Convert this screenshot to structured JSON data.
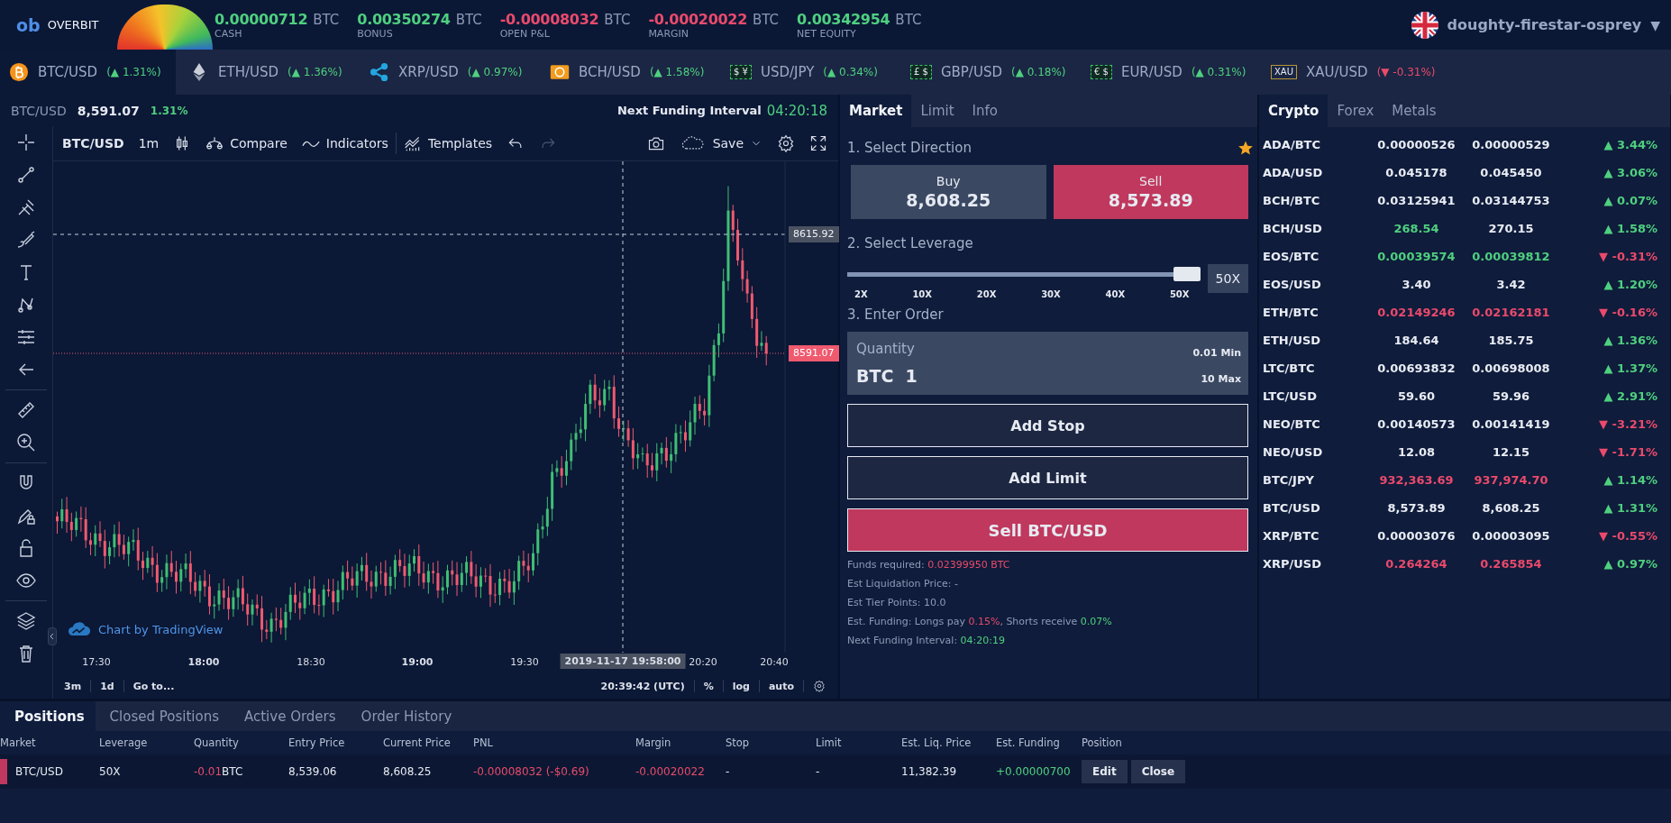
{
  "header": {
    "logo_mark": "ob",
    "logo": "OVERBIT",
    "balances": [
      {
        "value": "0.00000712",
        "unit": "BTC",
        "label": "CASH",
        "color": "#4fd07f"
      },
      {
        "value": "0.00350274",
        "unit": "BTC",
        "label": "BONUS",
        "color": "#4fd07f"
      },
      {
        "value": "-0.00008032",
        "unit": "BTC",
        "label": "OPEN P&L",
        "color": "#ea4a6c"
      },
      {
        "value": "-0.00020022",
        "unit": "BTC",
        "label": "MARGIN",
        "color": "#ea4a6c"
      },
      {
        "value": "0.00342954",
        "unit": "BTC",
        "label": "NET EQUITY",
        "color": "#4fd07f"
      }
    ],
    "user": {
      "name": "doughty-firestar-osprey",
      "caret": "▼"
    }
  },
  "tickers": [
    {
      "kind": "coin",
      "pair": "BTC/USD",
      "change": "(▲ 1.31%)",
      "color": "#4fd07f",
      "selected": true
    },
    {
      "kind": "coin",
      "pair": "ETH/USD",
      "change": "(▲ 1.36%)",
      "color": "#4fd07f",
      "selected": false
    },
    {
      "kind": "coin",
      "pair": "XRP/USD",
      "change": "(▲ 0.97%)",
      "color": "#4fd07f",
      "selected": false
    },
    {
      "kind": "coin",
      "pair": "BCH/USD",
      "change": "(▲ 1.58%)",
      "color": "#4fd07f",
      "selected": false
    },
    {
      "kind": "fx",
      "badge": "$ ¥",
      "pair": "USD/JPY",
      "change": "(▲ 0.34%)",
      "color": "#4fd07f",
      "selected": false
    },
    {
      "kind": "fx",
      "badge": "£ $",
      "pair": "GBP/USD",
      "change": "(▲ 0.18%)",
      "color": "#4fd07f",
      "selected": false
    },
    {
      "kind": "fx",
      "badge": "€ $",
      "pair": "EUR/USD",
      "change": "(▲ 0.31%)",
      "color": "#4fd07f",
      "selected": false
    },
    {
      "kind": "metal",
      "badge": "XAU",
      "pair": "XAU/USD",
      "change": "(▼ -0.31%)",
      "color": "#ea4a6c",
      "selected": false
    }
  ],
  "chart": {
    "symbol": "BTC/USD",
    "price": "8,591.07",
    "change": "1.31%",
    "funding_label": "Next Funding Interval",
    "funding_time": "04:20:18",
    "toolbar": {
      "symbol": "BTC/USD",
      "interval": "1m",
      "compare": "Compare",
      "indicators": "Indicators",
      "templates": "Templates",
      "save": "Save"
    },
    "crosshair_price": "8615.92",
    "last_price": "8591.07",
    "credit": "Chart by TradingView",
    "time_labels": [
      {
        "text": "17:30",
        "major": false
      },
      {
        "text": "18:00",
        "major": true
      },
      {
        "text": "18:30",
        "major": false
      },
      {
        "text": "19:00",
        "major": true
      },
      {
        "text": "19:30",
        "major": false
      },
      {
        "text": "20:20",
        "major": false
      },
      {
        "text": "20:40",
        "major": false
      }
    ],
    "crosshair_time": "2019-11-17 19:58:00",
    "ranges": [
      "3m",
      "1d"
    ],
    "goto": "Go to...",
    "clock": "20:39:42 (UTC)",
    "scale_options": [
      "%",
      "log",
      "auto"
    ]
  },
  "order": {
    "tabs": [
      {
        "label": "Market",
        "selected": true
      },
      {
        "label": "Limit",
        "selected": false
      },
      {
        "label": "Info",
        "selected": false
      }
    ],
    "step1": "1. Select Direction",
    "favorite": true,
    "directions": [
      {
        "label": "Buy",
        "price": "8,608.25",
        "selected": false
      },
      {
        "label": "Sell",
        "price": "8,573.89",
        "selected": true
      }
    ],
    "step2": "2. Select Leverage",
    "leverage": {
      "level": 1,
      "ticks": [
        "2X",
        "10X",
        "20X",
        "30X",
        "40X",
        "50X"
      ],
      "value": "50X"
    },
    "step3": "3. Enter Order",
    "quantity": {
      "label": "Quantity",
      "unit": "BTC",
      "value": "1",
      "min": "0.01 Min",
      "max": "10 Max"
    },
    "add_stop": "Add Stop",
    "add_limit": "Add Limit",
    "submit": "Sell BTC/USD",
    "info": [
      {
        "parts": [
          {
            "text": "Funds required: "
          },
          {
            "text": "0.02399950 BTC",
            "color": "#ea4a6c"
          }
        ]
      },
      {
        "parts": [
          {
            "text": "Est Liquidation Price: -"
          }
        ]
      },
      {
        "parts": [
          {
            "text": "Est Tier Points: 10.0"
          }
        ]
      },
      {
        "parts": [
          {
            "text": "Est. Funding: Longs pay "
          },
          {
            "text": "0.15%",
            "color": "#ea4a6c"
          },
          {
            "text": ", Shorts receive "
          },
          {
            "text": "0.07%",
            "color": "#4fd07f"
          }
        ]
      },
      {
        "parts": [
          {
            "text": "Next Funding Interval: "
          },
          {
            "text": "04:20:19",
            "color": "#4fd07f"
          }
        ]
      }
    ]
  },
  "markets": {
    "tabs": [
      {
        "label": "Crypto",
        "selected": true
      },
      {
        "label": "Forex",
        "selected": false
      },
      {
        "label": "Metals",
        "selected": false
      }
    ],
    "rows": [
      {
        "pair": "ADA/BTC",
        "bid": {
          "text": "0.00000526",
          "color": "#e8ecf4"
        },
        "ask": {
          "text": "0.00000529",
          "color": "#e8ecf4"
        },
        "change": {
          "text": "▲ 3.44%",
          "color": "#4fd07f"
        }
      },
      {
        "pair": "ADA/USD",
        "bid": {
          "text": "0.045178",
          "color": "#e8ecf4"
        },
        "ask": {
          "text": "0.045450",
          "color": "#e8ecf4"
        },
        "change": {
          "text": "▲ 3.06%",
          "color": "#4fd07f"
        }
      },
      {
        "pair": "BCH/BTC",
        "bid": {
          "text": "0.03125941",
          "color": "#e8ecf4"
        },
        "ask": {
          "text": "0.03144753",
          "color": "#e8ecf4"
        },
        "change": {
          "text": "▲ 0.07%",
          "color": "#4fd07f"
        }
      },
      {
        "pair": "BCH/USD",
        "bid": {
          "text": "268.54",
          "color": "#4fd07f"
        },
        "ask": {
          "text": "270.15",
          "color": "#e8ecf4"
        },
        "change": {
          "text": "▲ 1.58%",
          "color": "#4fd07f"
        }
      },
      {
        "pair": "EOS/BTC",
        "bid": {
          "text": "0.00039574",
          "color": "#4fd07f"
        },
        "ask": {
          "text": "0.00039812",
          "color": "#4fd07f"
        },
        "change": {
          "text": "▼ -0.31%",
          "color": "#ea4a6c"
        }
      },
      {
        "pair": "EOS/USD",
        "bid": {
          "text": "3.40",
          "color": "#e8ecf4"
        },
        "ask": {
          "text": "3.42",
          "color": "#e8ecf4"
        },
        "change": {
          "text": "▲ 1.20%",
          "color": "#4fd07f"
        }
      },
      {
        "pair": "ETH/BTC",
        "bid": {
          "text": "0.02149246",
          "color": "#ea4a6c"
        },
        "ask": {
          "text": "0.02162181",
          "color": "#ea4a6c"
        },
        "change": {
          "text": "▼ -0.16%",
          "color": "#ea4a6c"
        }
      },
      {
        "pair": "ETH/USD",
        "bid": {
          "text": "184.64",
          "color": "#e8ecf4"
        },
        "ask": {
          "text": "185.75",
          "color": "#e8ecf4"
        },
        "change": {
          "text": "▲ 1.36%",
          "color": "#4fd07f"
        }
      },
      {
        "pair": "LTC/BTC",
        "bid": {
          "text": "0.00693832",
          "color": "#e8ecf4"
        },
        "ask": {
          "text": "0.00698008",
          "color": "#e8ecf4"
        },
        "change": {
          "text": "▲ 1.37%",
          "color": "#4fd07f"
        }
      },
      {
        "pair": "LTC/USD",
        "bid": {
          "text": "59.60",
          "color": "#e8ecf4"
        },
        "ask": {
          "text": "59.96",
          "color": "#e8ecf4"
        },
        "change": {
          "text": "▲ 2.91%",
          "color": "#4fd07f"
        }
      },
      {
        "pair": "NEO/BTC",
        "bid": {
          "text": "0.00140573",
          "color": "#e8ecf4"
        },
        "ask": {
          "text": "0.00141419",
          "color": "#e8ecf4"
        },
        "change": {
          "text": "▼ -3.21%",
          "color": "#ea4a6c"
        }
      },
      {
        "pair": "NEO/USD",
        "bid": {
          "text": "12.08",
          "color": "#e8ecf4"
        },
        "ask": {
          "text": "12.15",
          "color": "#e8ecf4"
        },
        "change": {
          "text": "▼ -1.71%",
          "color": "#ea4a6c"
        }
      },
      {
        "pair": "BTC/JPY",
        "bid": {
          "text": "932,363.69",
          "color": "#ea4a6c"
        },
        "ask": {
          "text": "937,974.70",
          "color": "#ea4a6c"
        },
        "change": {
          "text": "▲ 1.14%",
          "color": "#4fd07f"
        }
      },
      {
        "pair": "BTC/USD",
        "bid": {
          "text": "8,573.89",
          "color": "#e8ecf4"
        },
        "ask": {
          "text": "8,608.25",
          "color": "#e8ecf4"
        },
        "change": {
          "text": "▲ 1.31%",
          "color": "#4fd07f"
        }
      },
      {
        "pair": "XRP/BTC",
        "bid": {
          "text": "0.00003076",
          "color": "#e8ecf4"
        },
        "ask": {
          "text": "0.00003095",
          "color": "#e8ecf4"
        },
        "change": {
          "text": "▼ -0.55%",
          "color": "#ea4a6c"
        }
      },
      {
        "pair": "XRP/USD",
        "bid": {
          "text": "0.264264",
          "color": "#ea4a6c"
        },
        "ask": {
          "text": "0.265854",
          "color": "#ea4a6c"
        },
        "change": {
          "text": "▲ 0.97%",
          "color": "#4fd07f"
        }
      }
    ]
  },
  "positions": {
    "tabs": [
      {
        "label": "Positions",
        "selected": true
      },
      {
        "label": "Closed Positions",
        "selected": false
      },
      {
        "label": "Active Orders",
        "selected": false
      },
      {
        "label": "Order History",
        "selected": false
      }
    ],
    "columns": [
      "Market",
      "Leverage",
      "Quantity",
      "Entry Price",
      "Current Price",
      "PNL",
      "Margin",
      "Stop",
      "Limit",
      "Est. Liq. Price",
      "Est. Funding",
      "Position"
    ],
    "rows": [
      {
        "color": "#c0385d",
        "cells": [
          {
            "text": "BTC/USD"
          },
          {
            "text": "50X"
          },
          {
            "text": "-0.01",
            "color": "#ea4a6c",
            "unit": "BTC"
          },
          {
            "text": "8,539.06"
          },
          {
            "text": "8,608.25"
          },
          {
            "text": "-0.00008032 (-$0.69)",
            "color": "#ea4a6c"
          },
          {
            "text": "-0.00020022",
            "color": "#ea4a6c"
          },
          {
            "text": "-"
          },
          {
            "text": "-"
          },
          {
            "text": "11,382.39"
          },
          {
            "text": "+0.00000700",
            "color": "#4fd07f"
          }
        ],
        "actions": [
          "Edit",
          "Close"
        ]
      }
    ]
  }
}
